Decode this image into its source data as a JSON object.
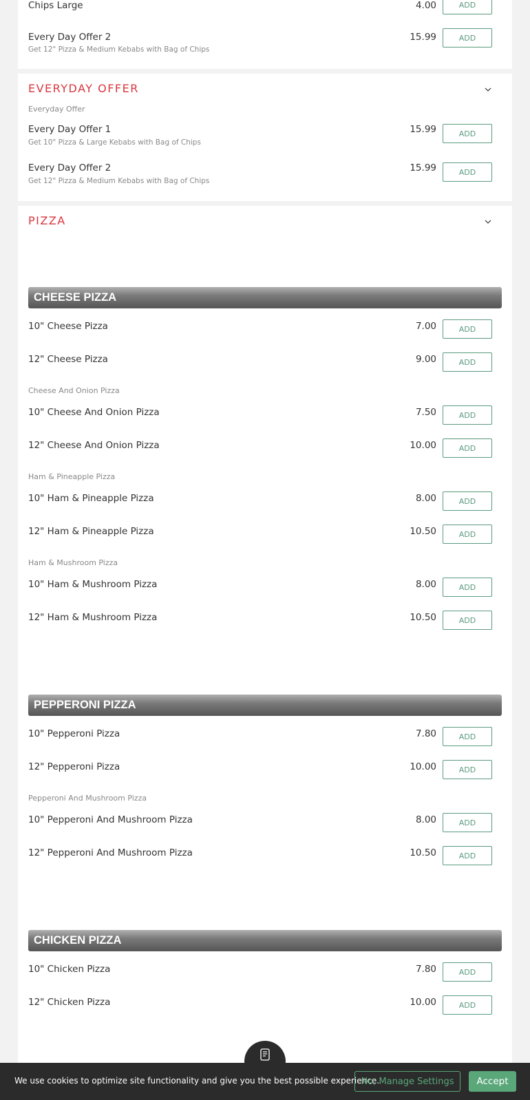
{
  "top_items": [
    {
      "name": "Chips Large",
      "price": "4.00",
      "add": "ADD"
    },
    {
      "name": "Every Day Offer 2",
      "desc": "Get 12\" Pizza & Medium Kebabs with Bag of Chips",
      "price": "15.99",
      "add": "ADD"
    }
  ],
  "everyday_offer": {
    "title": "EVERYDAY OFFER",
    "subheading": "Everyday Offer",
    "items": [
      {
        "name": "Every Day Offer 1",
        "desc": "Get 10\" Pizza & Large Kebabs with Bag of Chips",
        "price": "15.99",
        "add": "ADD"
      },
      {
        "name": "Every Day Offer 2",
        "desc": "Get 12\" Pizza & Medium Kebabs with Bag of Chips",
        "price": "15.99",
        "add": "ADD"
      }
    ]
  },
  "pizza": {
    "title": "PIZZA",
    "cheese": {
      "bar": "CHEESE PIZZA",
      "items": [
        {
          "name": "10\" Cheese Pizza",
          "price": "7.00",
          "add": "ADD"
        },
        {
          "name": "12\" Cheese Pizza",
          "price": "9.00",
          "add": "ADD"
        }
      ],
      "onion_label": "Cheese And Onion Pizza",
      "onion_items": [
        {
          "name": "10\" Cheese And Onion Pizza",
          "price": "7.50",
          "add": "ADD"
        },
        {
          "name": "12\" Cheese And Onion Pizza",
          "price": "10.00",
          "add": "ADD"
        }
      ],
      "ham_pineapple_label": "Ham & Pineapple Pizza",
      "ham_pineapple_items": [
        {
          "name": "10\" Ham & Pineapple Pizza",
          "price": "8.00",
          "add": "ADD"
        },
        {
          "name": "12\" Ham & Pineapple Pizza",
          "price": "10.50",
          "add": "ADD"
        }
      ],
      "ham_mushroom_label": "Ham & Mushroom Pizza",
      "ham_mushroom_items": [
        {
          "name": "10\" Ham & Mushroom Pizza",
          "price": "8.00",
          "add": "ADD"
        },
        {
          "name": "12\" Ham & Mushroom Pizza",
          "price": "10.50",
          "add": "ADD"
        }
      ]
    },
    "pepperoni": {
      "bar": "PEPPERONI PIZZA",
      "items": [
        {
          "name": "10\" Pepperoni Pizza",
          "price": "7.80",
          "add": "ADD"
        },
        {
          "name": "12\" Pepperoni Pizza",
          "price": "10.00",
          "add": "ADD"
        }
      ],
      "mushroom_label": "Pepperoni And Mushroom Pizza",
      "mushroom_items": [
        {
          "name": "10\" Pepperoni And Mushroom Pizza",
          "price": "8.00",
          "add": "ADD"
        },
        {
          "name": "12\" Pepperoni And Mushroom Pizza",
          "price": "10.50",
          "add": "ADD"
        }
      ]
    },
    "chicken": {
      "bar": "CHICKEN PIZZA",
      "items": [
        {
          "name": "10\" Chicken Pizza",
          "price": "7.80",
          "add": "ADD"
        },
        {
          "name": "12\" Chicken Pizza",
          "price": "10.00",
          "add": "ADD"
        }
      ]
    }
  },
  "cookie": {
    "text": "We use cookies to optimize site functionality and give you the best possible experience.",
    "manage": "No, Manage Settings",
    "accept": "Accept"
  },
  "icons": {
    "chevron": "chevron-down-icon",
    "basket": "basket-icon"
  },
  "colors": {
    "category_red": "#d9363e",
    "add_green": "#5a9a7e",
    "cookie_bg": "#2b2b2b",
    "accept_green": "#5aa77a"
  }
}
